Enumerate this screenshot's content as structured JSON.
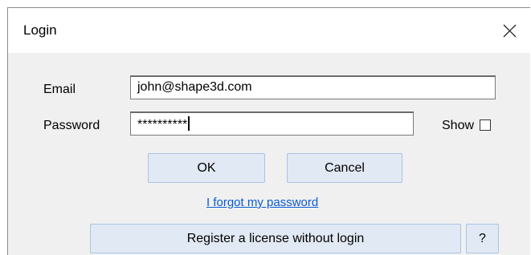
{
  "window": {
    "title": "Login"
  },
  "form": {
    "email_label": "Email",
    "email_value": "john@shape3d.com",
    "password_label": "Password",
    "password_value": "**********",
    "show_label": "Show",
    "show_checked": false
  },
  "buttons": {
    "ok": "OK",
    "cancel": "Cancel",
    "register": "Register a license without login",
    "help": "?"
  },
  "links": {
    "forgot_password": "I forgot my password"
  },
  "icons": {
    "close": "close-icon"
  }
}
